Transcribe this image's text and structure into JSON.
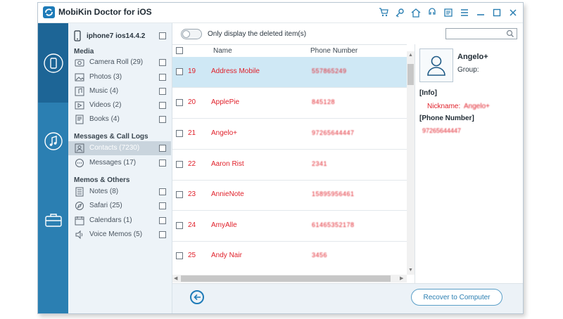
{
  "window": {
    "title": "MobiKin Doctor for iOS"
  },
  "titlebar_icons": [
    "cart-icon",
    "key-icon",
    "home-icon",
    "support-icon",
    "feedback-icon",
    "menu-icon",
    "minimize-icon",
    "maximize-icon",
    "close-icon"
  ],
  "device": {
    "name": "iphone7 ios14.4.2"
  },
  "sections": {
    "media": "Media",
    "messages": "Messages & Call Logs",
    "memos": "Memos & Others"
  },
  "categories": [
    {
      "label": "Camera Roll  (29)",
      "icon": "camera-icon"
    },
    {
      "label": "Photos  (3)",
      "icon": "photo-icon"
    },
    {
      "label": "Music  (4)",
      "icon": "music-icon"
    },
    {
      "label": "Videos  (2)",
      "icon": "video-icon"
    },
    {
      "label": "Books  (4)",
      "icon": "book-icon"
    },
    {
      "label": "Contacts  (7230)",
      "icon": "contact-icon"
    },
    {
      "label": "Messages  (17)",
      "icon": "message-icon"
    },
    {
      "label": "Notes  (8)",
      "icon": "note-icon"
    },
    {
      "label": "Safari  (25)",
      "icon": "compass-icon"
    },
    {
      "label": "Calendars  (1)",
      "icon": "calendar-icon"
    },
    {
      "label": "Voice Memos  (5)",
      "icon": "speaker-icon"
    }
  ],
  "toolbar": {
    "toggle_label": "Only display the deleted item(s)",
    "search_placeholder": ""
  },
  "table": {
    "headers": {
      "name": "Name",
      "phone": "Phone Number"
    },
    "rows": [
      {
        "num": "19",
        "name": "Address Mobile",
        "phone": "557865249"
      },
      {
        "num": "20",
        "name": "ApplePie",
        "phone": "845128"
      },
      {
        "num": "21",
        "name": "Angelo+",
        "phone": "97265644447"
      },
      {
        "num": "22",
        "name": "Aaron Rist",
        "phone": "2341"
      },
      {
        "num": "23",
        "name": "AnnieNote",
        "phone": "15895956461"
      },
      {
        "num": "24",
        "name": "AmyAlle",
        "phone": "61465352178"
      },
      {
        "num": "25",
        "name": "Andy Nair",
        "phone": "3456"
      }
    ]
  },
  "detail": {
    "name": "Angelo+",
    "group_label": "Group:",
    "info_header": "[Info]",
    "nickname_label": "Nickname:",
    "nickname_value": "Angelo+",
    "phone_header": "[Phone Number]",
    "phone_value": "97265644447"
  },
  "bottom": {
    "recover_label": "Recover to Computer"
  },
  "colors": {
    "accent": "#2b7fb2",
    "selected_row": "#cfe8f5",
    "deleted_text": "#e0202a"
  }
}
